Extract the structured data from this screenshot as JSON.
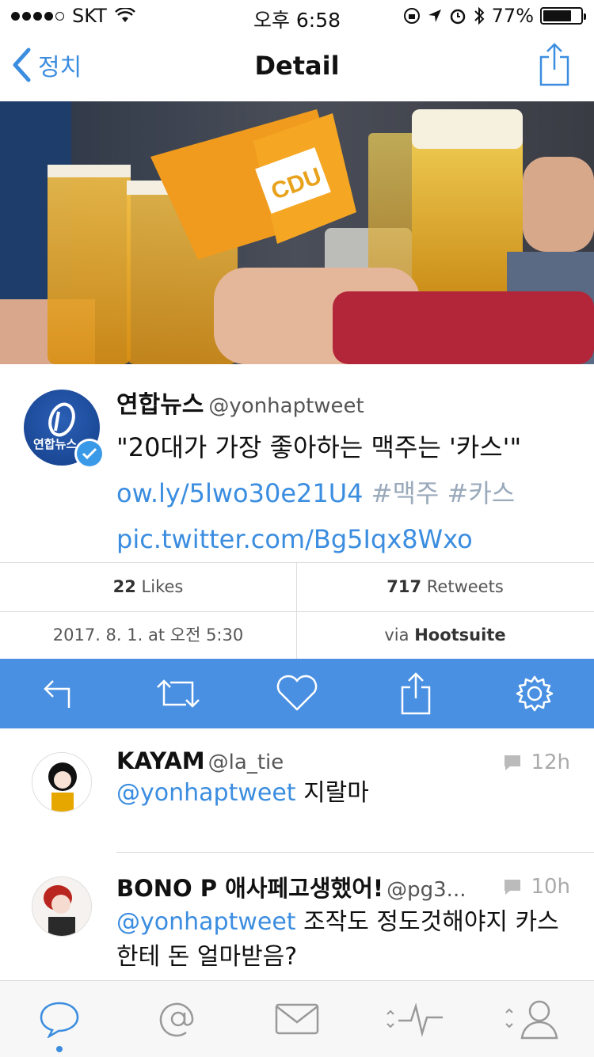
{
  "status": {
    "carrier": "SKT",
    "time": "오후 6:58",
    "battery": "77%",
    "battery_level": 0.77
  },
  "nav": {
    "back_label": "정치",
    "title": "Detail"
  },
  "tweet": {
    "name": "연합뉴스",
    "handle": "@yonhaptweet",
    "text": "\"20대가 가장 좋아하는 맥주는 '카스'\"",
    "link": "ow.ly/5lwo30e21U4",
    "tags": [
      "#맥주",
      "#카스"
    ],
    "pic_link": "pic.twitter.com/Bg5Iqx8Wxo",
    "avatar_text": "연합뉴스"
  },
  "stats": {
    "likes_count": "22",
    "likes_label": "Likes",
    "retweets_count": "717",
    "retweets_label": "Retweets",
    "date": "2017. 8. 1. at 오전 5:30",
    "via_label": "via",
    "via_source": "Hootsuite"
  },
  "replies": [
    {
      "name": "KAYAM",
      "handle": "@la_tie",
      "time": "12h",
      "mention": "@yonhaptweet",
      "text": " 지랄마"
    },
    {
      "name": "BONO P 애사페고생했어!",
      "handle": "@pg3...",
      "time": "10h",
      "mention": "@yonhaptweet",
      "text": " 조작도 정도것해야지 카스한테 돈 얼마받음?"
    }
  ],
  "colors": {
    "accent": "#4a90e2",
    "link": "#3b8de0"
  },
  "icons": {
    "action_bar": [
      "reply-icon",
      "retweet-icon",
      "like-icon",
      "share-icon",
      "settings-icon"
    ],
    "tab_bar": [
      "timeline-icon",
      "mentions-icon",
      "messages-icon",
      "activity-icon",
      "profile-icon"
    ]
  }
}
